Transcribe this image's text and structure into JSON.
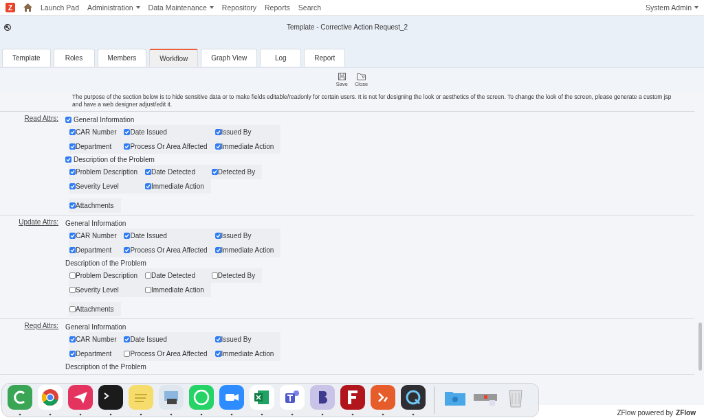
{
  "nav": {
    "logo": "Z",
    "items": [
      {
        "label": "Launch Pad",
        "dropdown": false
      },
      {
        "label": "Administration",
        "dropdown": true
      },
      {
        "label": "Data Maintenance",
        "dropdown": true
      },
      {
        "label": "Repository",
        "dropdown": false
      },
      {
        "label": "Reports",
        "dropdown": false
      },
      {
        "label": "Search",
        "dropdown": false
      }
    ],
    "user": "System Admin"
  },
  "title": "Template - Corrective Action Request_2",
  "tabs": [
    {
      "label": "Template",
      "selected": false
    },
    {
      "label": "Roles",
      "selected": false
    },
    {
      "label": "Members",
      "selected": false
    },
    {
      "label": "Workflow",
      "selected": true
    },
    {
      "label": "Graph View",
      "selected": false
    },
    {
      "label": "Log",
      "selected": false
    },
    {
      "label": "Report",
      "selected": false
    }
  ],
  "toolbar": [
    {
      "label": "Save",
      "kind": "save"
    },
    {
      "label": "Close",
      "kind": "close"
    }
  ],
  "notice": "The purpose of the section below is to hide sensitive data or to make fields editable/readonly for certain users. It is not for designing the look or aesthetics of the screen. To change the look of the screen, please generate a custom jsp and have a web designer adjust/edit it.",
  "sections": [
    {
      "label": "Read Attrs:",
      "groups": [
        {
          "kind": "checkbox",
          "title": "General Information",
          "checked": true,
          "rows": [
            [
              {
                "label": "CAR Number",
                "checked": true
              },
              {
                "label": "Date Issued",
                "checked": true
              },
              {
                "label": "Issued By",
                "checked": true
              }
            ],
            [
              {
                "label": "Department",
                "checked": true
              },
              {
                "label": "Process Or Area Affected",
                "checked": true
              },
              {
                "label": "Immediate Action",
                "checked": true
              }
            ]
          ]
        },
        {
          "kind": "checkbox",
          "title": "Description of the Problem",
          "checked": true,
          "rows": [
            [
              {
                "label": "Problem Description",
                "checked": true
              },
              {
                "label": "Date Detected",
                "checked": true
              },
              {
                "label": "Detected By",
                "checked": true
              }
            ],
            [
              {
                "label": "Severity Level",
                "checked": true
              },
              {
                "label": "Immediate Action",
                "checked": true
              }
            ]
          ]
        },
        {
          "kind": "none",
          "rows": [
            [
              {
                "label": "Attachments",
                "checked": true
              }
            ]
          ]
        }
      ]
    },
    {
      "label": "Update Attrs:",
      "groups": [
        {
          "kind": "plain",
          "title": "General Information",
          "rows": [
            [
              {
                "label": "CAR Number",
                "checked": true
              },
              {
                "label": "Date Issued",
                "checked": true
              },
              {
                "label": "Issued By",
                "checked": true
              }
            ],
            [
              {
                "label": "Department",
                "checked": true
              },
              {
                "label": "Process Or Area Affected",
                "checked": true
              },
              {
                "label": "Immediate Action",
                "checked": true
              }
            ]
          ]
        },
        {
          "kind": "plain",
          "title": "Description of the Problem",
          "rows": [
            [
              {
                "label": "Problem Description",
                "checked": false
              },
              {
                "label": "Date Detected",
                "checked": false
              },
              {
                "label": "Detected By",
                "checked": false
              }
            ],
            [
              {
                "label": "Severity Level",
                "checked": false
              },
              {
                "label": "Immediate Action",
                "checked": false
              }
            ]
          ]
        },
        {
          "kind": "none",
          "rows": [
            [
              {
                "label": "Attachments",
                "checked": false
              }
            ]
          ]
        }
      ]
    },
    {
      "label": "Reqd Attrs:",
      "groups": [
        {
          "kind": "plain",
          "title": "General Information",
          "rows": [
            [
              {
                "label": "CAR Number",
                "checked": true
              },
              {
                "label": "Date Issued",
                "checked": true
              },
              {
                "label": "Issued By",
                "checked": true
              }
            ],
            [
              {
                "label": "Department",
                "checked": true
              },
              {
                "label": "Process Or Area Affected",
                "checked": false
              },
              {
                "label": "Immediate Action",
                "checked": true
              }
            ]
          ]
        },
        {
          "kind": "plain",
          "title": "Description of the Problem"
        }
      ]
    }
  ],
  "footer": {
    "text": "ZFlow powered by",
    "brand": "ZFlow"
  }
}
